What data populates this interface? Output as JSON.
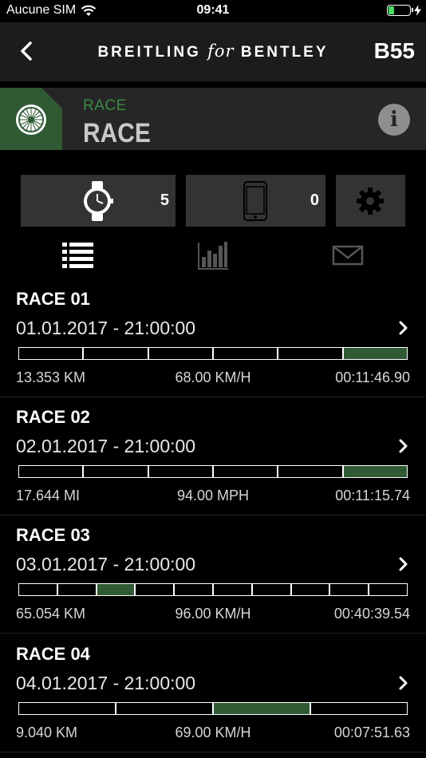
{
  "status": {
    "carrier": "Aucune SIM",
    "time": "09:41"
  },
  "nav": {
    "brand_left": "BREITLING",
    "brand_mid": "for",
    "brand_right": "BENTLEY",
    "model": "B55"
  },
  "header": {
    "subtitle": "RACE",
    "title": "RACE",
    "info_glyph": "i"
  },
  "devices": {
    "watch_count": "5",
    "phone_count": "0"
  },
  "tabs": [
    "list-icon",
    "chart-icon",
    "mail-icon"
  ],
  "colors": {
    "accent": "#2f5a34",
    "panel": "#262626",
    "button": "#333333"
  },
  "races": [
    {
      "title": "RACE 01",
      "date": "01.01.2017 - 21:00:00",
      "distance": "13.353 KM",
      "speed": "68.00 KM/H",
      "time": "00:11:46.90",
      "segments": 6,
      "active": [
        5
      ]
    },
    {
      "title": "RACE 02",
      "date": "02.01.2017 - 21:00:00",
      "distance": "17.644 MI",
      "speed": "94.00 MPH",
      "time": "00:11:15.74",
      "segments": 6,
      "active": [
        5
      ]
    },
    {
      "title": "RACE 03",
      "date": "03.01.2017 - 21:00:00",
      "distance": "65.054 KM",
      "speed": "96.00 KM/H",
      "time": "00:40:39.54",
      "segments": 10,
      "active": [
        2
      ]
    },
    {
      "title": "RACE 04",
      "date": "04.01.2017 - 21:00:00",
      "distance": "9.040 KM",
      "speed": "69.00 KM/H",
      "time": "00:07:51.63",
      "segments": 4,
      "active": [
        2
      ]
    }
  ]
}
